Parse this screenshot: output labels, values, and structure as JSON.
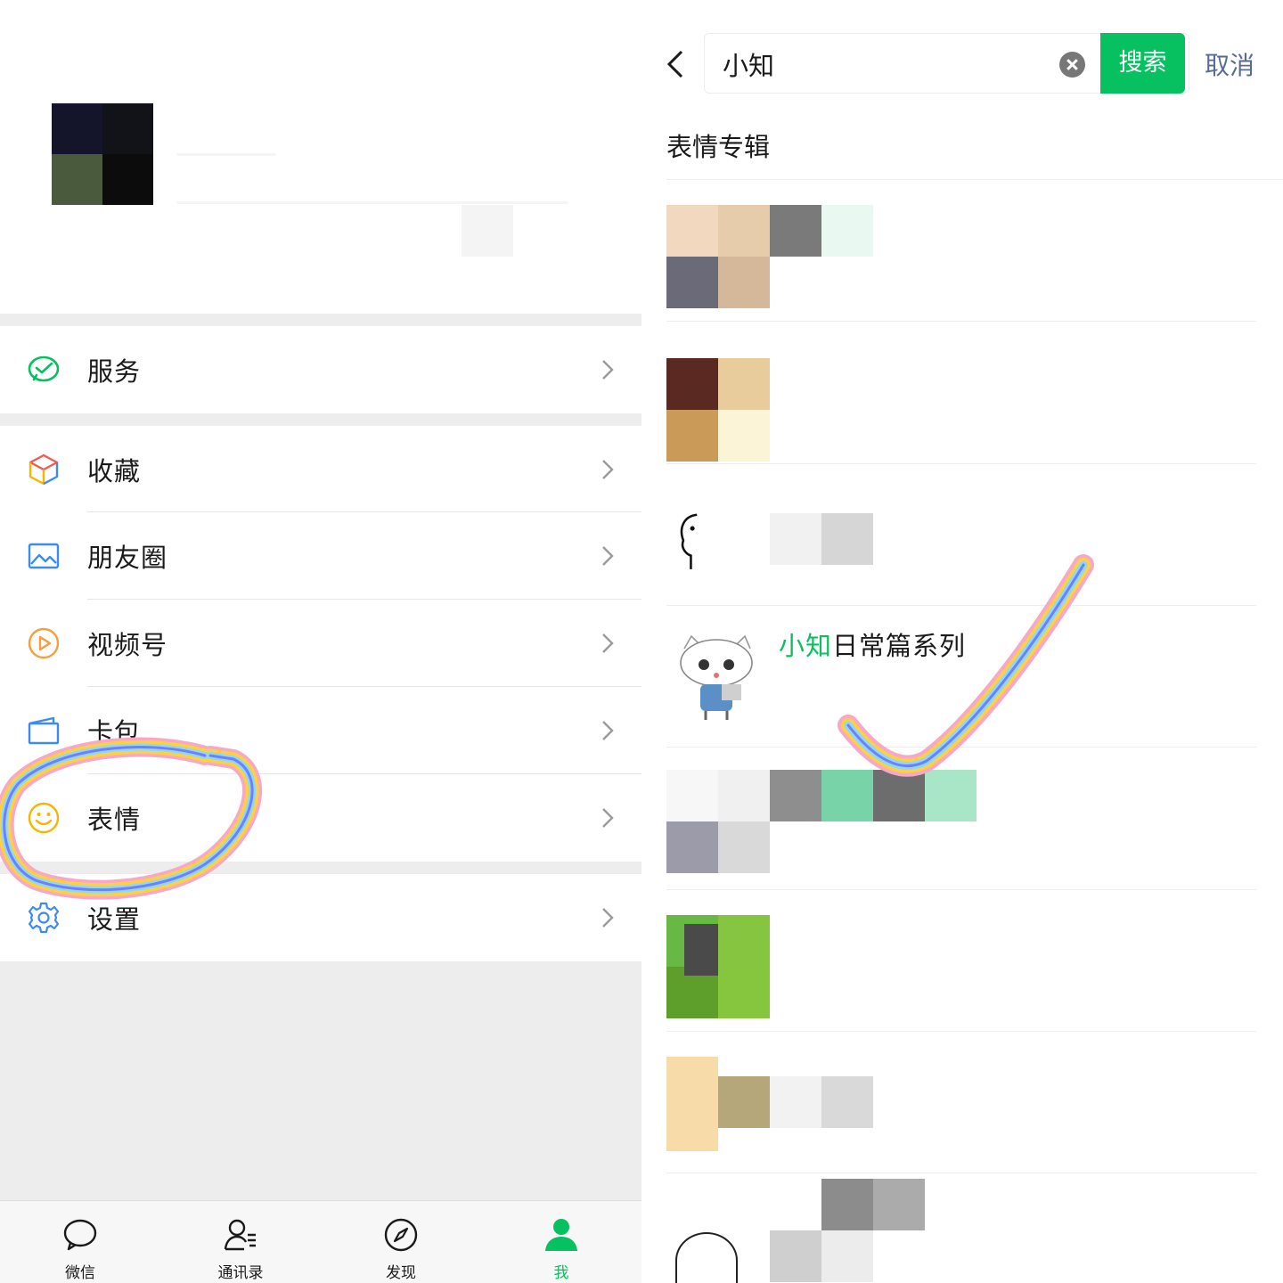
{
  "me_page": {
    "menu": [
      {
        "id": "services",
        "label": "服务",
        "icon": "wechat-pay-icon"
      },
      {
        "id": "favorites",
        "label": "收藏",
        "icon": "cube-icon"
      },
      {
        "id": "moments",
        "label": "朋友圈",
        "icon": "image-icon"
      },
      {
        "id": "channels",
        "label": "视频号",
        "icon": "play-icon"
      },
      {
        "id": "cards",
        "label": "卡包",
        "icon": "card-wallet-icon"
      },
      {
        "id": "stickers",
        "label": "表情",
        "icon": "smile-icon"
      },
      {
        "id": "settings",
        "label": "设置",
        "icon": "gear-icon"
      }
    ],
    "tabbar": [
      {
        "label": "微信",
        "icon": "chat-bubble-icon",
        "active": false
      },
      {
        "label": "通讯录",
        "icon": "contacts-icon",
        "active": false
      },
      {
        "label": "发现",
        "icon": "compass-icon",
        "active": false
      },
      {
        "label": "我",
        "icon": "person-icon",
        "active": true
      }
    ],
    "highlight_target": "表情"
  },
  "sticker_search": {
    "query": "小知",
    "search_button": "搜索",
    "cancel": "取消",
    "section_title": "表情专辑",
    "featured_result": {
      "highlight": "小知",
      "rest": "日常篇系列"
    },
    "result_count_visible": 8
  },
  "colors": {
    "wechat_green": "#07c160",
    "link_blue": "#576b95",
    "background_gray": "#ededed"
  }
}
